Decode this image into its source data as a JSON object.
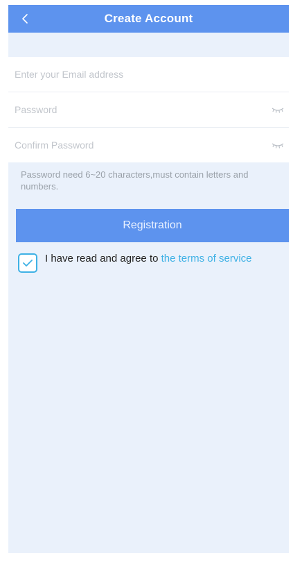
{
  "navbar": {
    "title": "Create Account",
    "back_icon": "chevron-left-icon"
  },
  "form": {
    "email": {
      "placeholder": "Enter your Email address",
      "value": ""
    },
    "password": {
      "placeholder": "Password",
      "value": "",
      "toggle_icon": "eye-closed-icon"
    },
    "confirm_password": {
      "placeholder": "Confirm Password",
      "value": "",
      "toggle_icon": "eye-closed-icon"
    }
  },
  "hint": "Password need 6~20 characters,must contain letters and numbers.",
  "register_button": {
    "label": "Registration"
  },
  "agreement": {
    "checked": true,
    "check_icon": "checkmark-icon",
    "text": "I have read and agree to ",
    "link_text": "the terms of service"
  },
  "colors": {
    "accent": "#5d93ee",
    "link": "#3eb1e5",
    "background": "#eaf1fb"
  }
}
